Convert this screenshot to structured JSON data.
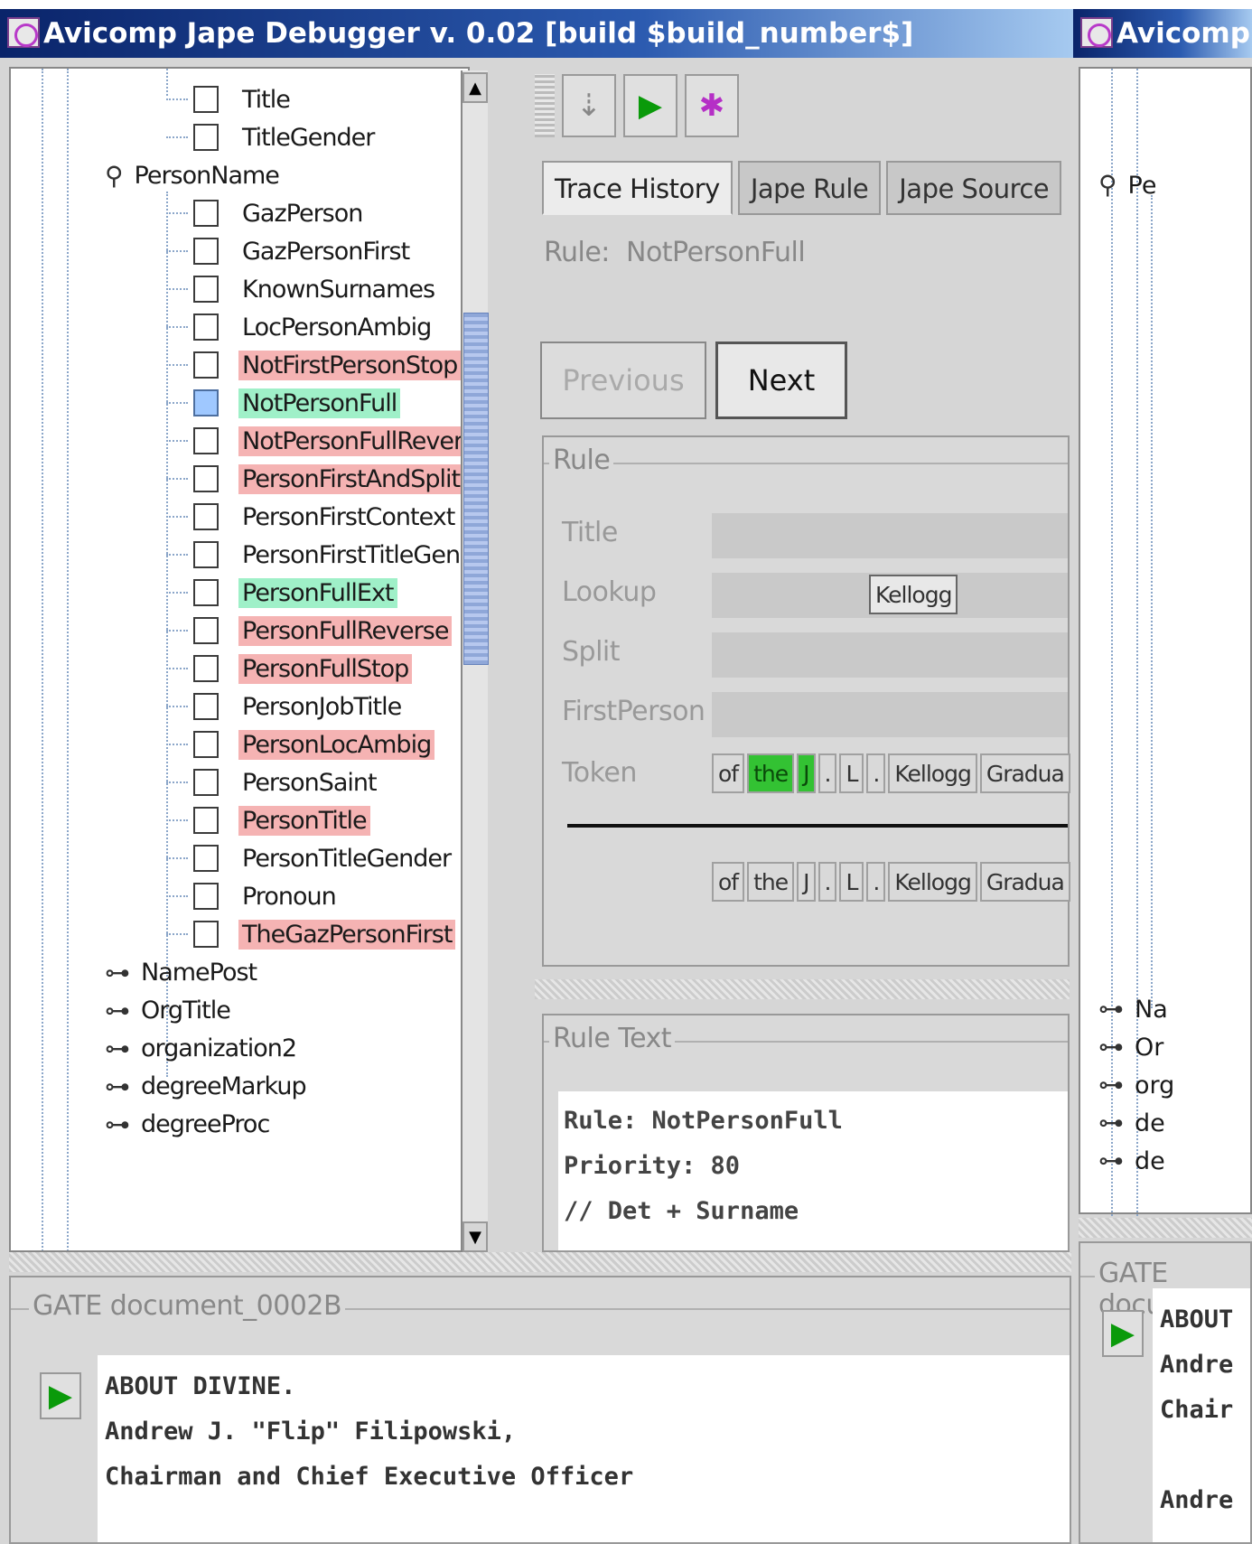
{
  "window1": {
    "title": "Avicomp Jape Debugger v. 0.02 [build $build_number$]",
    "tree": {
      "leaves_top": [
        {
          "label": "Title",
          "highlight": "none",
          "checked": false
        },
        {
          "label": "TitleGender",
          "highlight": "none",
          "checked": false
        }
      ],
      "expanded_node": "PersonName",
      "leaves": [
        {
          "label": "GazPerson",
          "highlight": "none",
          "checked": false
        },
        {
          "label": "GazPersonFirst",
          "highlight": "none",
          "checked": false
        },
        {
          "label": "KnownSurnames",
          "highlight": "none",
          "checked": false
        },
        {
          "label": "LocPersonAmbig",
          "highlight": "none",
          "checked": false
        },
        {
          "label": "NotFirstPersonStop",
          "highlight": "red",
          "checked": false
        },
        {
          "label": "NotPersonFull",
          "highlight": "green",
          "checked": true
        },
        {
          "label": "NotPersonFullRevers",
          "highlight": "red",
          "checked": false
        },
        {
          "label": "PersonFirstAndSplit",
          "highlight": "red",
          "checked": false
        },
        {
          "label": "PersonFirstContext",
          "highlight": "none",
          "checked": false
        },
        {
          "label": "PersonFirstTitleGend",
          "highlight": "none",
          "checked": false
        },
        {
          "label": "PersonFullExt",
          "highlight": "green",
          "checked": false
        },
        {
          "label": "PersonFullReverse",
          "highlight": "red",
          "checked": false
        },
        {
          "label": "PersonFullStop",
          "highlight": "red",
          "checked": false
        },
        {
          "label": "PersonJobTitle",
          "highlight": "none",
          "checked": false
        },
        {
          "label": "PersonLocAmbig",
          "highlight": "red",
          "checked": false
        },
        {
          "label": "PersonSaint",
          "highlight": "none",
          "checked": false
        },
        {
          "label": "PersonTitle",
          "highlight": "red",
          "checked": false
        },
        {
          "label": "PersonTitleGender",
          "highlight": "none",
          "checked": false
        },
        {
          "label": "Pronoun",
          "highlight": "none",
          "checked": false
        },
        {
          "label": "TheGazPersonFirst",
          "highlight": "red",
          "checked": false
        }
      ],
      "collapsed_nodes": [
        "NamePost",
        "OrgTitle",
        "organization2",
        "degreeMarkup",
        "degreeProc"
      ]
    },
    "tabs": [
      "Trace History",
      "Jape Rule",
      "Jape Source"
    ],
    "rule_label": "Rule:",
    "rule_name": "NotPersonFull",
    "buttons": {
      "previous": "Previous",
      "next": "Next"
    },
    "rule_group": {
      "legend": "Rule",
      "fields": [
        "Title",
        "Lookup",
        "Split",
        "FirstPerson",
        "Token"
      ],
      "lookup_value": "Kellogg",
      "token_row": [
        {
          "text": "of",
          "match": false
        },
        {
          "text": "the",
          "match": true
        },
        {
          "text": "J",
          "match": true
        },
        {
          "text": ".",
          "match": false
        },
        {
          "text": "L",
          "match": false
        },
        {
          "text": ".",
          "match": false
        },
        {
          "text": "Kellogg",
          "match": false
        },
        {
          "text": "Gradua",
          "match": false
        }
      ],
      "doc_row": [
        "of",
        "the",
        "J",
        ".",
        "L",
        ".",
        "Kellogg",
        "Gradua"
      ]
    },
    "rule_text": {
      "legend": "Rule Text",
      "lines": [
        "Rule: NotPersonFull",
        "Priority: 80",
        "// Det + Surname"
      ]
    },
    "gate": {
      "legend": "GATE document_0002B",
      "lines": [
        "ABOUT DIVINE.",
        "Andrew J. \"Flip\" Filipowski,",
        "Chairman and Chief Executive Officer"
      ]
    }
  },
  "window2": {
    "title": "Avicomp Ja",
    "tree_rows": [
      "Pe",
      "Na",
      "Or",
      "org",
      "de",
      "de"
    ],
    "gate": {
      "legend": "GATE docur",
      "lines": [
        "ABOUT",
        "Andre",
        "Chair",
        "",
        "Andre"
      ]
    }
  },
  "colors": {
    "title_bar": "#0a246a",
    "highlight_red": "#f5b3b3",
    "highlight_green": "#9ff0c8",
    "match_token": "#33c233"
  }
}
